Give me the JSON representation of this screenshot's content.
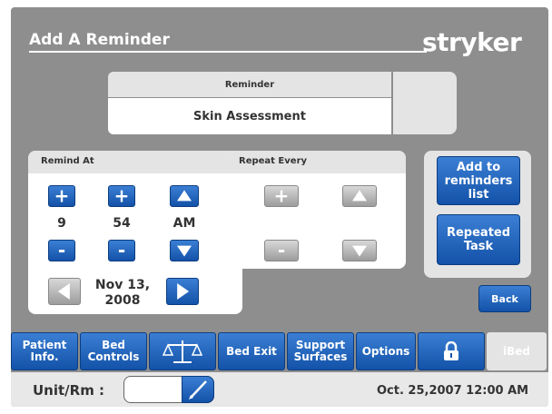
{
  "header": {
    "title": "Add A Reminder",
    "brand": "stryker"
  },
  "reminder": {
    "header_label": "Reminder",
    "value": "Skin Assessment"
  },
  "remind_at": {
    "label": "Remind At",
    "hour": "9",
    "minute": "54",
    "ampm": "AM",
    "date_line1": "Nov 13,",
    "date_line2": "2008"
  },
  "repeat_every": {
    "label": "Repeat Every"
  },
  "symbols": {
    "plus": "+",
    "minus": "-"
  },
  "actions": {
    "add_label": "Add to reminders list",
    "repeated_label": "Repeated Task",
    "back_label": "Back"
  },
  "nav": {
    "patient_info": "Patient Info.",
    "bed_controls": "Bed Controls",
    "scale_icon": "scale-icon",
    "bed_exit": "Bed Exit",
    "support_surfaces": "Support Surfaces",
    "options": "Options",
    "lock_icon": "lock-icon",
    "bed": "iBed"
  },
  "footer": {
    "unit_label": "Unit/Rm :",
    "unit_value": "",
    "datetime": "Oct. 25,2007  12:00 AM"
  },
  "colors": {
    "background": "#8e8e8e",
    "panel": "#e4e4e4",
    "button_blue": "#1f64c0",
    "button_gray": "#b0b0b0"
  }
}
